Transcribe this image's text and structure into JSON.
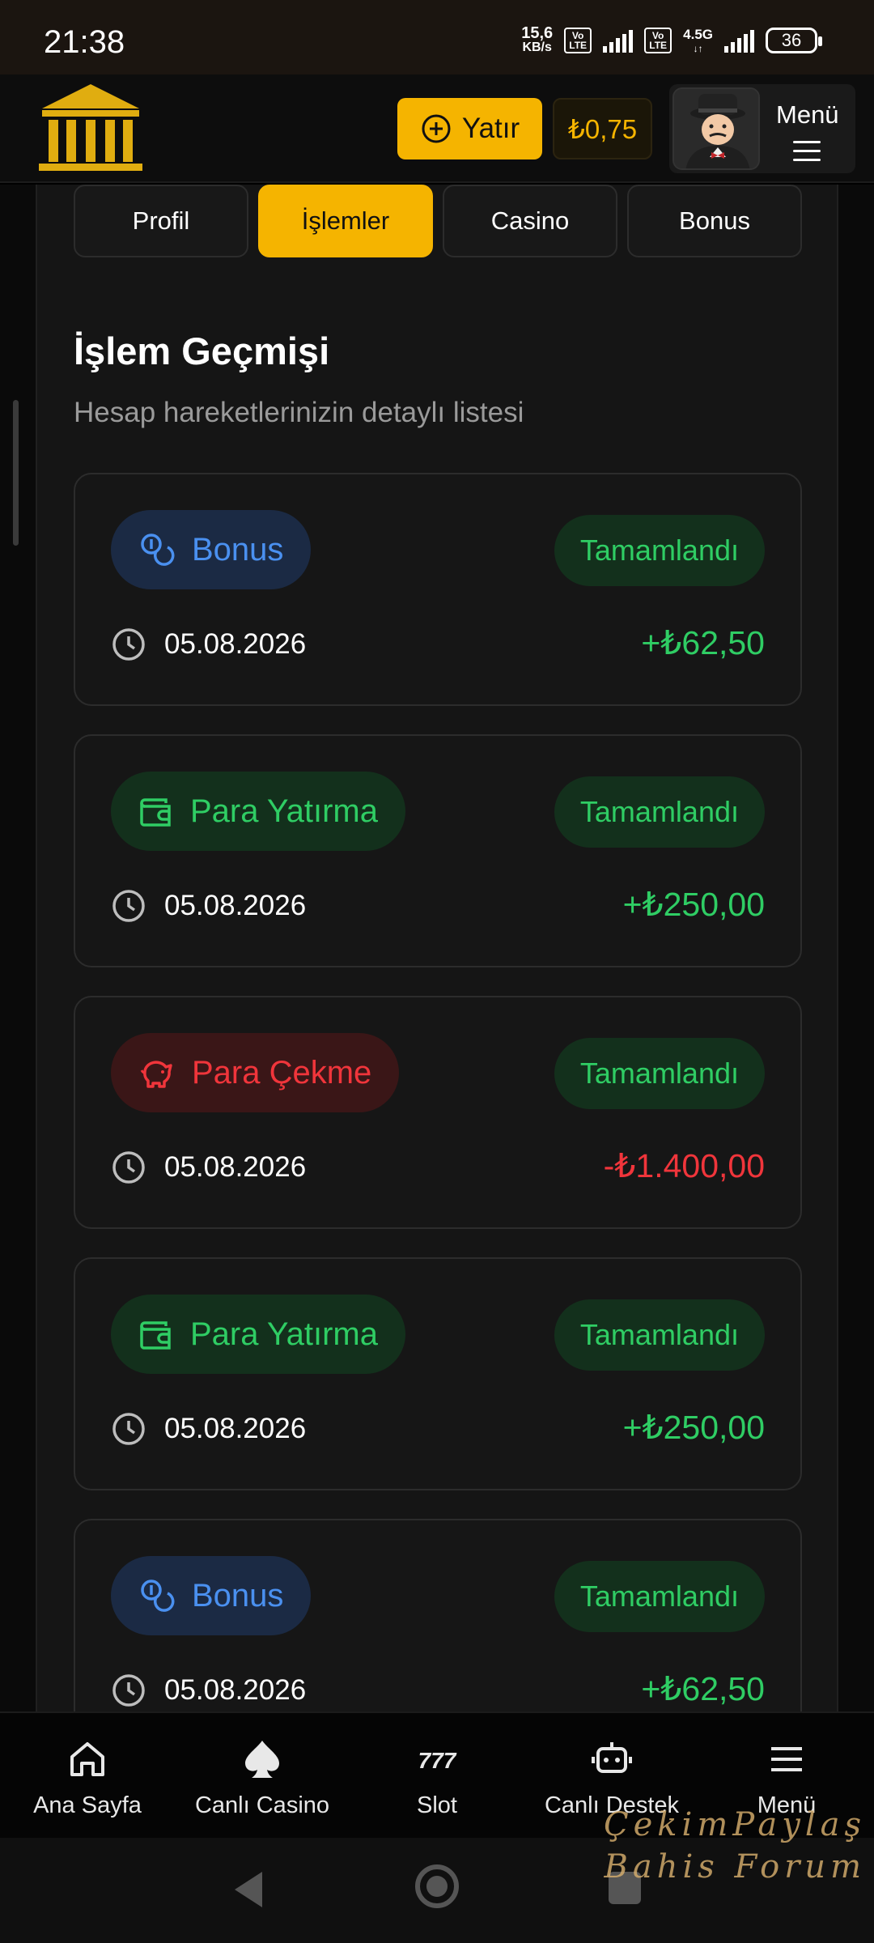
{
  "status_bar": {
    "time": "21:38",
    "net_speed_value": "15,6",
    "net_speed_unit": "KB/s",
    "volte_label": "Vo LTE",
    "network": "4.5G",
    "battery": "36"
  },
  "header": {
    "deposit_label": "Yatır",
    "balance": "₺0,75",
    "menu_label": "Menü"
  },
  "tabs": [
    {
      "label": "Profil",
      "active": false
    },
    {
      "label": "İşlemler",
      "active": true
    },
    {
      "label": "Casino",
      "active": false
    },
    {
      "label": "Bonus",
      "active": false
    }
  ],
  "page": {
    "title": "İşlem Geçmişi",
    "subtitle": "Hesap hareketlerinizin detaylı listesi"
  },
  "transactions": [
    {
      "type": "Bonus",
      "icon": "coins-icon",
      "status": "Tamamlandı",
      "date": "05.08.2026",
      "amount": "+₺62,50"
    },
    {
      "type": "Para Yatırma",
      "icon": "wallet-icon",
      "status": "Tamamlandı",
      "date": "05.08.2026",
      "amount": "+₺250,00"
    },
    {
      "type": "Para Çekme",
      "icon": "piggy-bank-icon",
      "status": "Tamamlandı",
      "date": "05.08.2026",
      "amount": "-₺1.400,00"
    },
    {
      "type": "Para Yatırma",
      "icon": "wallet-icon",
      "status": "Tamamlandı",
      "date": "05.08.2026",
      "amount": "+₺250,00"
    },
    {
      "type": "Bonus",
      "icon": "coins-icon",
      "status": "Tamamlandı",
      "date": "05.08.2026",
      "amount": "+₺62,50"
    }
  ],
  "bottom_nav": [
    {
      "label": "Ana Sayfa",
      "icon": "home-icon"
    },
    {
      "label": "Canlı Casino",
      "icon": "spade-icon"
    },
    {
      "label": "Slot",
      "icon": "slot-777-icon"
    },
    {
      "label": "Canlı Destek",
      "icon": "robot-icon"
    },
    {
      "label": "Menü",
      "icon": "menu-icon"
    }
  ],
  "watermark": {
    "line1": "ÇekimPaylaş",
    "line2": "Bahis Forum"
  },
  "colors": {
    "accent": "#f5b400",
    "success": "#2fcd64",
    "danger": "#f0353b",
    "bonus": "#4a90f0"
  }
}
